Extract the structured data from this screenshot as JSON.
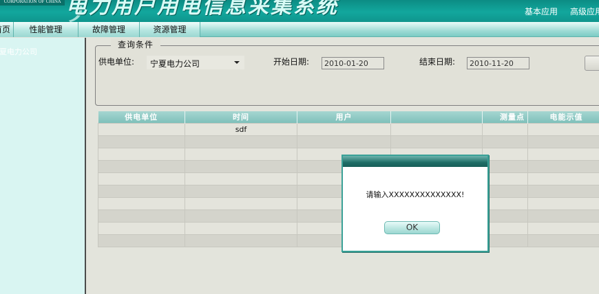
{
  "header": {
    "logo_text": "CORPORATION OF CHINA",
    "system_title": "电力用户用电信息采集系统",
    "links": [
      "基本应用",
      "高级应用"
    ]
  },
  "menu": {
    "items": [
      "首页",
      "性能管理",
      "故障管理",
      "资源管理"
    ]
  },
  "sidebar": {
    "items": [
      "宁夏电力公司"
    ]
  },
  "query": {
    "legend": "查询条件",
    "supply_unit_label": "供电单位:",
    "supply_unit_value": "宁夏电力公司",
    "start_date_label": "开始日期:",
    "start_date_value": "2010-01-20",
    "end_date_label": "结束日期:",
    "end_date_value": "2010-11-20",
    "query_button": ""
  },
  "table": {
    "headers": [
      "供电单位",
      "时间",
      "用户",
      "",
      "测量点",
      "电能示值"
    ],
    "rows": [
      [
        "",
        "sdf",
        "",
        "",
        "",
        ""
      ],
      [
        "",
        "",
        "",
        "",
        "",
        ""
      ],
      [
        "",
        "",
        "",
        "",
        "",
        ""
      ],
      [
        "",
        "",
        "",
        "",
        "",
        ""
      ],
      [
        "",
        "",
        "",
        "",
        "",
        ""
      ],
      [
        "",
        "",
        "",
        "",
        "",
        ""
      ],
      [
        "",
        "",
        "",
        "",
        "",
        ""
      ],
      [
        "",
        "",
        "",
        "",
        "",
        ""
      ],
      [
        "",
        "",
        "",
        "",
        "",
        ""
      ],
      [
        "",
        "",
        "",
        "",
        "",
        ""
      ]
    ]
  },
  "dialog": {
    "title": "",
    "message": "请输入XXXXXXXXXXXXXX!",
    "ok_label": "OK"
  },
  "colors": {
    "header_teal": "#12a79d",
    "dialog_title": "#1e6d66",
    "table_header": "#8ccac4"
  }
}
